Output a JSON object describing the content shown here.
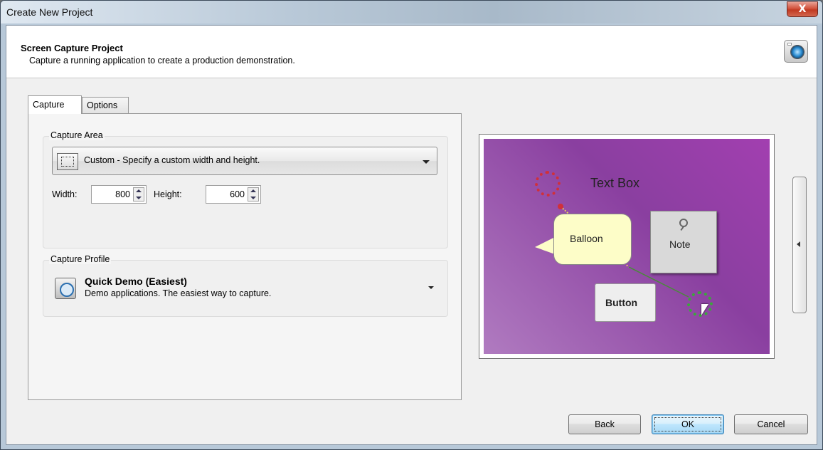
{
  "window": {
    "title": "Create New Project",
    "close_label": "X"
  },
  "header": {
    "title": "Screen Capture Project",
    "subtitle": "Capture a running application to create a production demonstration."
  },
  "tabs": [
    {
      "label": "Capture",
      "active": true
    },
    {
      "label": "Options",
      "active": false
    }
  ],
  "capture_area": {
    "group_label": "Capture Area",
    "selected": "Custom - Specify a custom width and height.",
    "width_label": "Width:",
    "width_value": "800",
    "height_label": "Height:",
    "height_value": "600"
  },
  "capture_profile": {
    "group_label": "Capture Profile",
    "title": "Quick Demo (Easiest)",
    "description": "Demo applications. The easiest way to capture."
  },
  "preview": {
    "text_box": "Text Box",
    "balloon": "Balloon",
    "note": "Note",
    "button": "Button",
    "colors": {
      "background_start": "#a23fb0",
      "start_circle": "#d0303a",
      "end_circle": "#3aa83a"
    }
  },
  "footer": {
    "back": "Back",
    "ok": "OK",
    "cancel": "Cancel"
  }
}
